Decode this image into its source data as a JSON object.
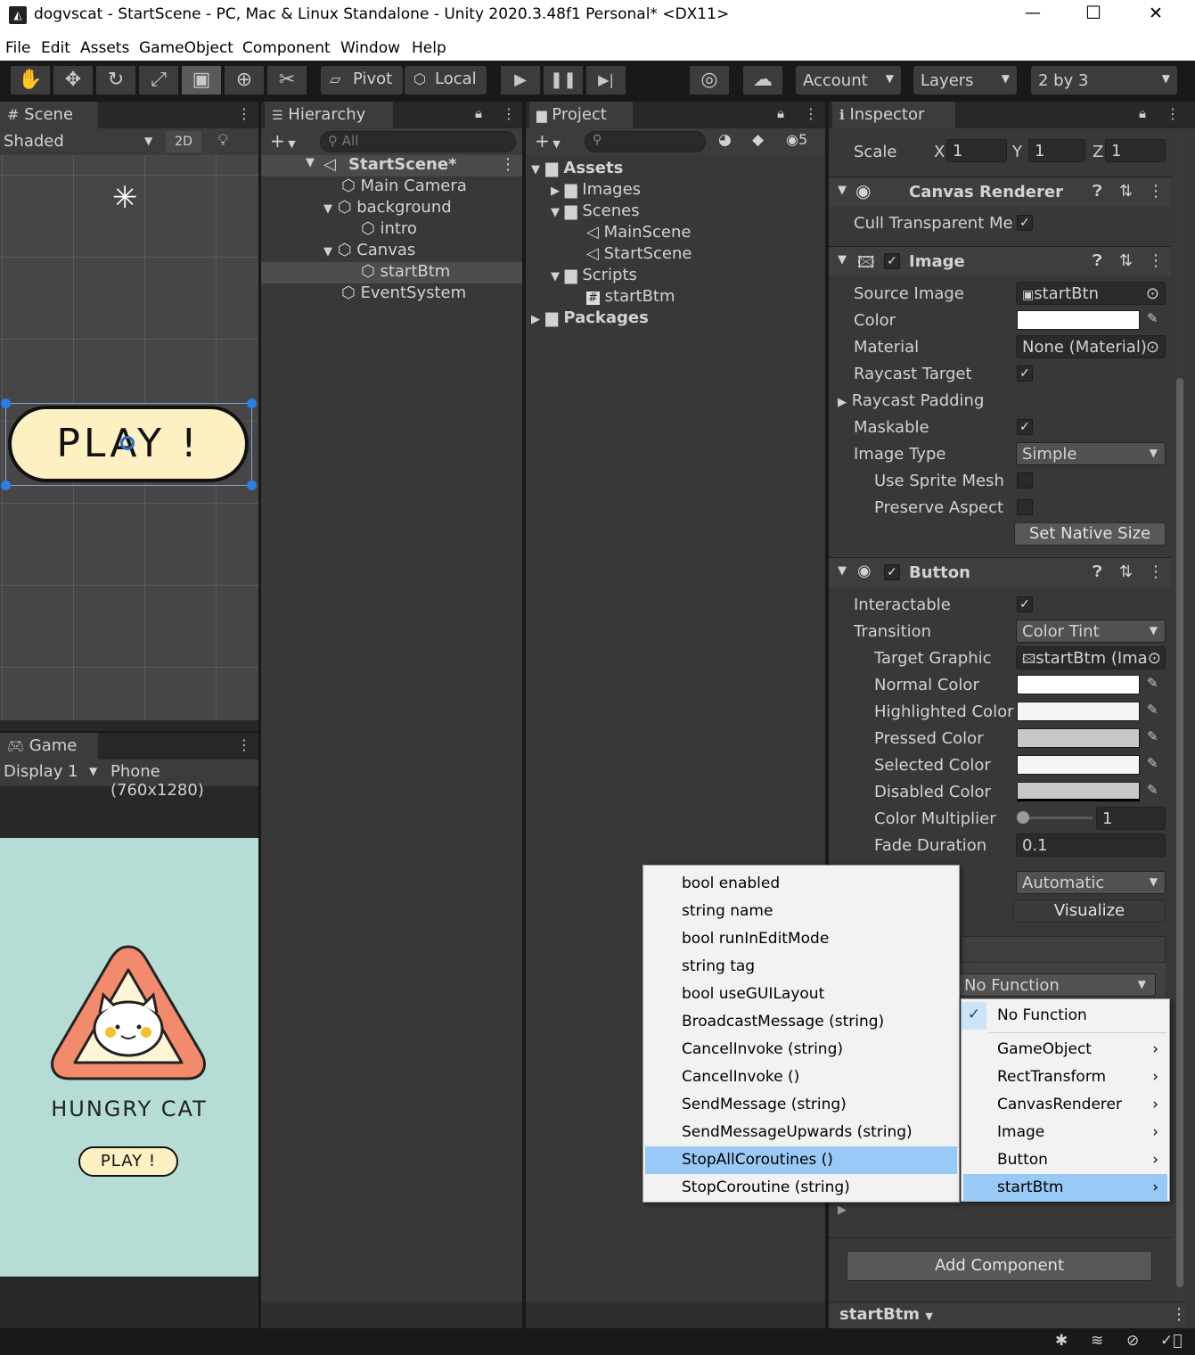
{
  "window": {
    "title": "dogvscat - StartScene - PC, Mac & Linux Standalone - Unity 2020.3.48f1 Personal* <DX11>",
    "min": "—",
    "max": "☐",
    "close": "✕"
  },
  "menu": [
    "File",
    "Edit",
    "Assets",
    "GameObject",
    "Component",
    "Window",
    "Help"
  ],
  "toolbar": {
    "pivot": "Pivot",
    "local": "Local",
    "account": "Account",
    "layers": "Layers",
    "layout": "2 by 3"
  },
  "scene": {
    "tab": "Scene",
    "shading": "Shaded",
    "mode2d": "2D",
    "play_label": "PLAY !"
  },
  "game": {
    "tab": "Game",
    "display": "Display 1",
    "resolution": "Phone (760x1280)",
    "title": "HUNGRY CAT",
    "play_label": "PLAY !"
  },
  "hierarchy": {
    "tab": "Hierarchy",
    "search_placeholder": "All",
    "scene": "StartScene*",
    "items": [
      "Main Camera",
      "background",
      "intro",
      "Canvas",
      "startBtm",
      "EventSystem"
    ]
  },
  "project": {
    "tab": "Project",
    "hidden_count": "5",
    "items": [
      "Assets",
      "Images",
      "Scenes",
      "MainScene",
      "StartScene",
      "Scripts",
      "startBtm",
      "Packages"
    ]
  },
  "inspector": {
    "tab": "Inspector",
    "scale": {
      "label": "Scale",
      "x_label": "X",
      "x": "1",
      "y_label": "Y",
      "y": "1",
      "z_label": "Z",
      "z": "1"
    },
    "canvas_renderer": {
      "title": "Canvas Renderer",
      "cull": "Cull Transparent Me"
    },
    "image": {
      "title": "Image",
      "source_label": "Source Image",
      "source": "startBtn",
      "color_label": "Color",
      "material_label": "Material",
      "material": "None (Material)",
      "raycast_label": "Raycast Target",
      "padding_label": "Raycast Padding",
      "maskable_label": "Maskable",
      "type_label": "Image Type",
      "type": "Simple",
      "sprite_mesh_label": "Use Sprite Mesh",
      "preserve_label": "Preserve Aspect",
      "native_size": "Set Native Size"
    },
    "button": {
      "title": "Button",
      "interactable_label": "Interactable",
      "transition_label": "Transition",
      "transition": "Color Tint",
      "target_label": "Target Graphic",
      "target": "startBtm (Imag",
      "normal": "Normal Color",
      "highlighted": "Highlighted Color",
      "pressed": "Pressed Color",
      "selected": "Selected Color",
      "disabled": "Disabled Color",
      "multiplier_label": "Color Multiplier",
      "multiplier": "1",
      "fade_label": "Fade Duration",
      "fade": "0.1",
      "navigation": "Automatic",
      "visualize": "Visualize",
      "function": "No Function"
    },
    "add_component": "Add Component",
    "footer": "startBtm"
  },
  "colors": {
    "normal": "#ffffff",
    "highlighted": "#f5f5f5",
    "pressed": "#c8c8c8",
    "selected": "#f5f5f5",
    "disabled": "#c8c8c8",
    "highlight_menu": "#99c9f5",
    "game_bg": "#b5ddd6"
  },
  "method_menu": [
    "bool enabled",
    "string name",
    "bool runInEditMode",
    "string tag",
    "bool useGUILayout",
    "BroadcastMessage (string)",
    "CancelInvoke (string)",
    "CancelInvoke ()",
    "SendMessage (string)",
    "SendMessageUpwards (string)",
    "StopAllCoroutines ()",
    "StopCoroutine (string)"
  ],
  "component_menu": {
    "checked": "No Function",
    "items": [
      "GameObject",
      "RectTransform",
      "CanvasRenderer",
      "Image",
      "Button",
      "startBtm"
    ]
  }
}
